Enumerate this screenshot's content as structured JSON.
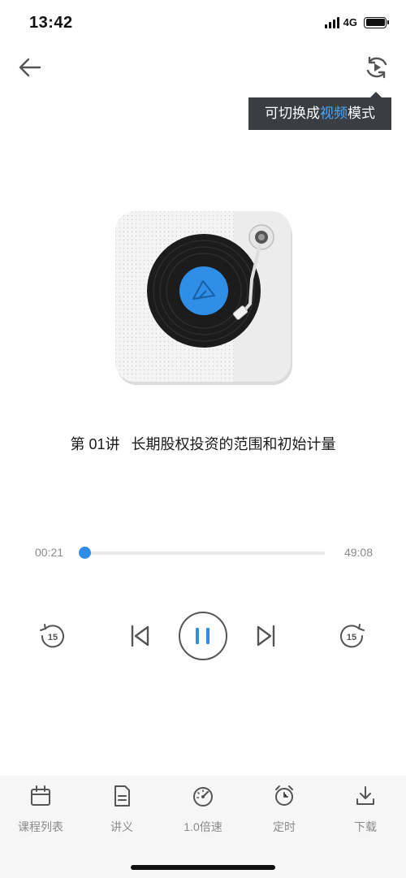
{
  "status_bar": {
    "time": "13:42",
    "network": "4G",
    "battery_level": 1.0
  },
  "header": {
    "back_icon": "arrow-left-icon",
    "mode_switch_icon": "switch-mode-icon"
  },
  "tooltip": {
    "text_before": "可切换成",
    "text_highlight": "视频",
    "text_after": "模式"
  },
  "lesson": {
    "number": "第 01讲",
    "title": "长期股权投资的范围和初始计量"
  },
  "player": {
    "current_time": "00:21",
    "total_time": "49:08",
    "progress_fraction": 0.007,
    "rewind_label": "15",
    "forward_label": "15",
    "state": "playing"
  },
  "bottom_tabs": [
    {
      "label": "课程列表",
      "icon": "calendar-icon"
    },
    {
      "label": "讲义",
      "icon": "document-icon"
    },
    {
      "label": "1.0倍速",
      "icon": "speedometer-icon"
    },
    {
      "label": "定时",
      "icon": "alarm-clock-icon"
    },
    {
      "label": "下载",
      "icon": "download-icon"
    }
  ],
  "colors": {
    "accent": "#2f8fe6",
    "tooltip_bg": "#3a3d42",
    "tooltip_highlight": "#4aa6ff",
    "bottom_bar_bg": "#f6f6f6"
  }
}
